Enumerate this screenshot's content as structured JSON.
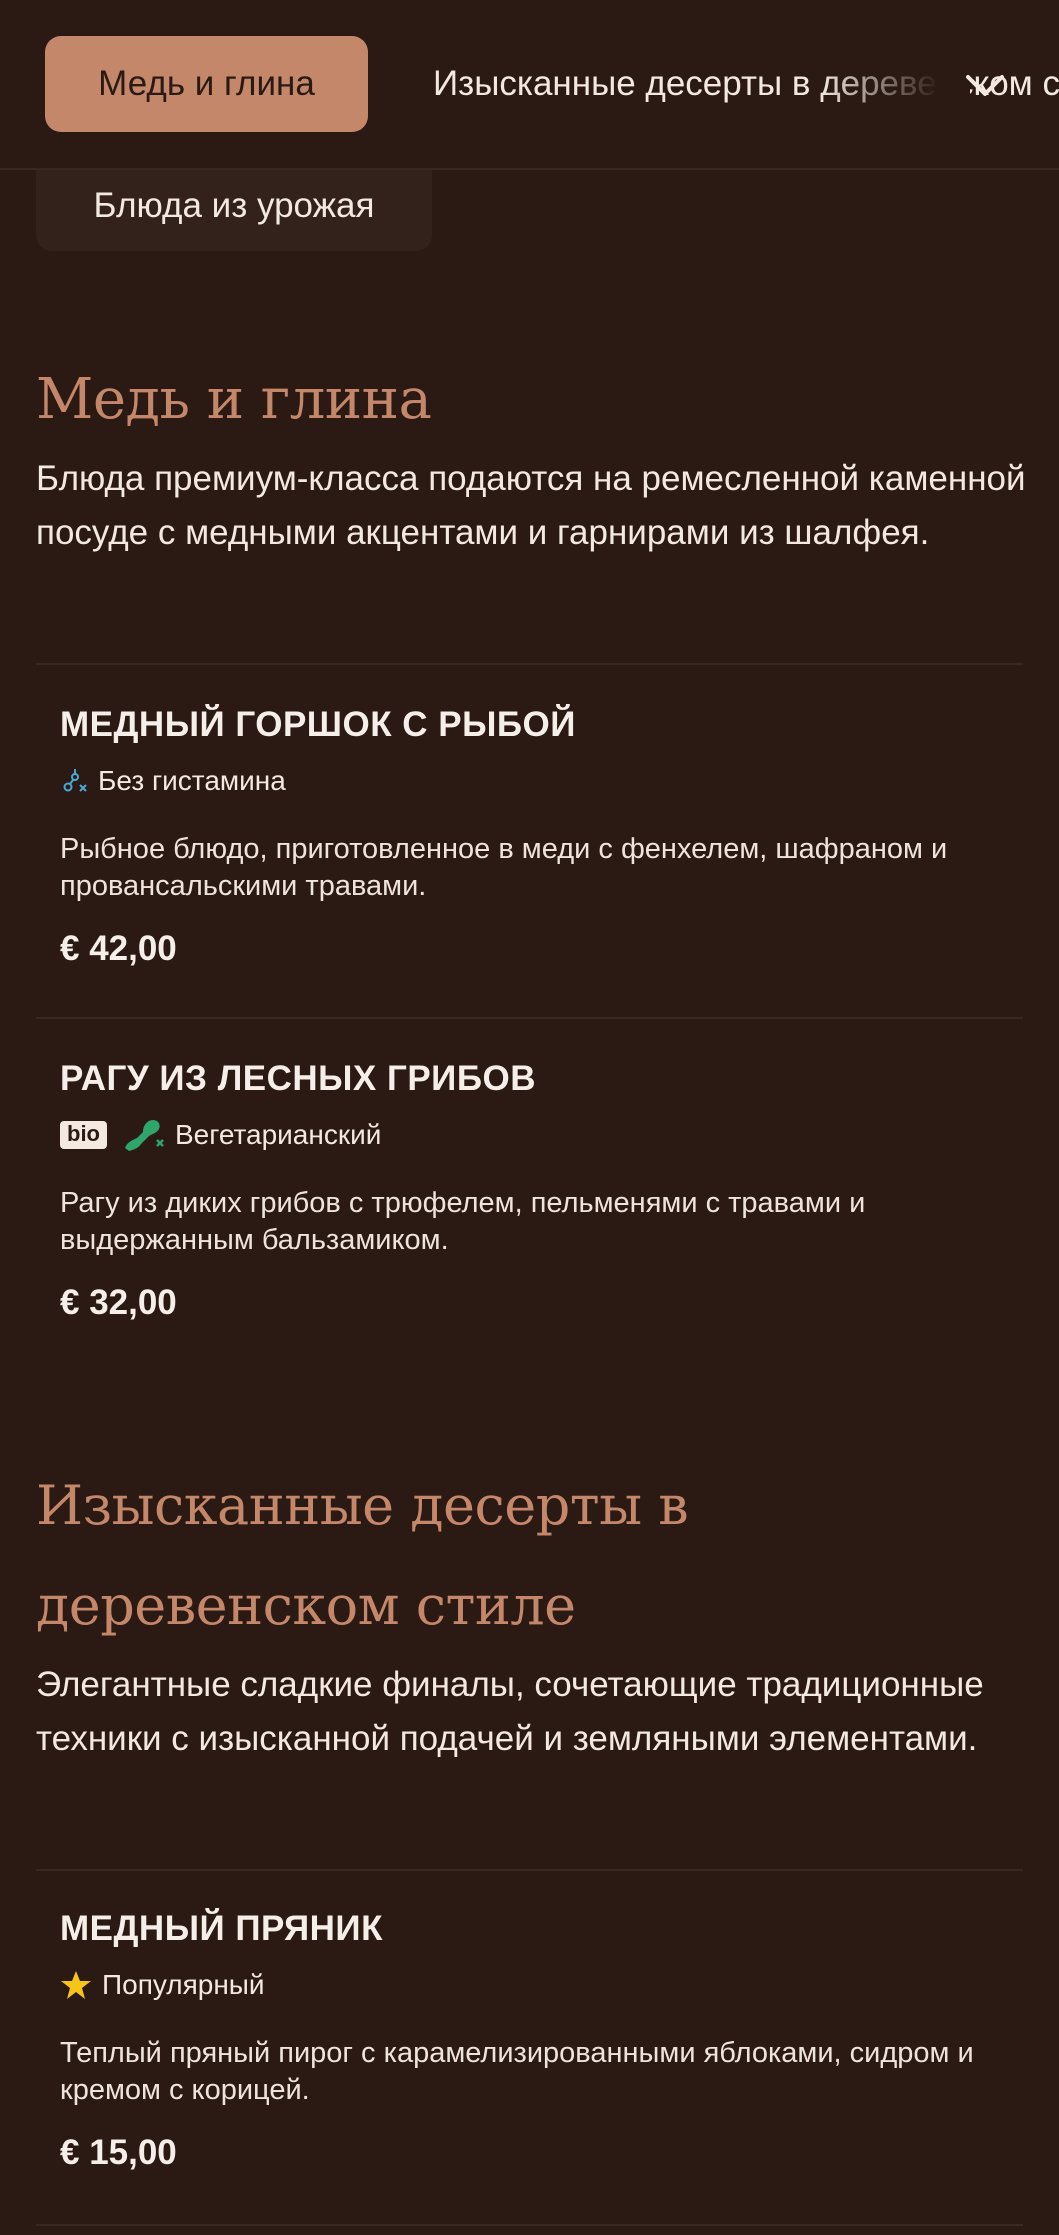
{
  "nav": {
    "active_tab": "Медь и глина",
    "next_tab": "Изысканные десерты в деревенском стиле",
    "hidden_pill": "Блюда из урожая"
  },
  "sections": [
    {
      "title": "Медь и глина",
      "description": "Блюда премиум-класса подаются на ремесленной каменной посуде с медными акцентами и гарнирами из шалфея.",
      "items": [
        {
          "name": "МЕДНЫЙ ГОРШОК С РЫБОЙ",
          "tags": [
            {
              "icon": "no-histamine-icon",
              "label": "Без гистамина"
            }
          ],
          "description": "Рыбное блюдо, приготовленное в меди с фенхелем, шафраном и провансальскими травами.",
          "price": "€ 42,00"
        },
        {
          "name": "РАГУ ИЗ ЛЕСНЫХ ГРИБОВ",
          "badge": "bio",
          "tags": [
            {
              "icon": "vegetarian-leg-crossed-icon",
              "label": "Вегетарианский"
            }
          ],
          "description": "Рагу из диких грибов с трюфелем, пельменями с травами и выдержанным бальзамиком.",
          "price": "€ 32,00"
        }
      ]
    },
    {
      "title": "Изысканные десерты в деревенском стиле",
      "description": "Элегантные сладкие финалы, сочетающие традиционные техники с изысканной подачей и земляными элементами.",
      "items": [
        {
          "name": "МЕДНЫЙ ПРЯНИК",
          "tags": [
            {
              "icon": "star-icon",
              "label": "Популярный"
            }
          ],
          "description": "Теплый пряный пирог с карамелизированными яблоками, сидром и кремом с корицей.",
          "price": "€ 15,00"
        }
      ]
    }
  ],
  "colors": {
    "background": "#2b1a14",
    "accent": "#c4876a",
    "text": "#f3e9e2",
    "star": "#f5c518",
    "vegetarian_icon": "#2fa46b",
    "histamine_icon": "#4aa8d8"
  }
}
